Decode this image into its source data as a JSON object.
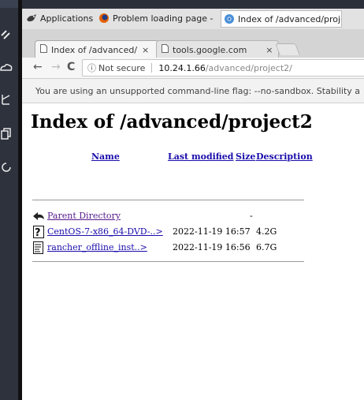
{
  "taskbar": {
    "items": [
      {
        "label": "Applications"
      },
      {
        "label": "Problem loading page - ..."
      },
      {
        "label": "Index of /advanced/proje..."
      }
    ]
  },
  "browser": {
    "tabs": [
      {
        "label": "Index of /advanced/",
        "close": "×"
      },
      {
        "label": "tools.google.com",
        "close": "×"
      }
    ],
    "address": {
      "security": "Not secure",
      "host": "10.24.1.66",
      "path": "/advanced/project2/"
    },
    "infobar": "You are using an unsupported command-line flag: --no-sandbox. Stability a"
  },
  "page": {
    "title": "Index of /advanced/project2",
    "columns": {
      "name": "Name",
      "modified": "Last modified",
      "size": "Size",
      "description": "Description"
    },
    "rows": [
      {
        "name": "Parent Directory",
        "modified": "",
        "size": "-",
        "icon": "back-icon"
      },
      {
        "name": "CentOS-7-x86_64-DVD-..>",
        "modified": "2022-11-19 16:57",
        "size": "4.2G",
        "icon": "unknown-file-icon"
      },
      {
        "name": "rancher_offline_inst..>",
        "modified": "2022-11-19 16:56",
        "size": "6.7G",
        "icon": "text-file-icon"
      }
    ]
  },
  "colors": {
    "link": "#1a0dab",
    "visited": "#551a8b",
    "dock": "#2d323d"
  }
}
